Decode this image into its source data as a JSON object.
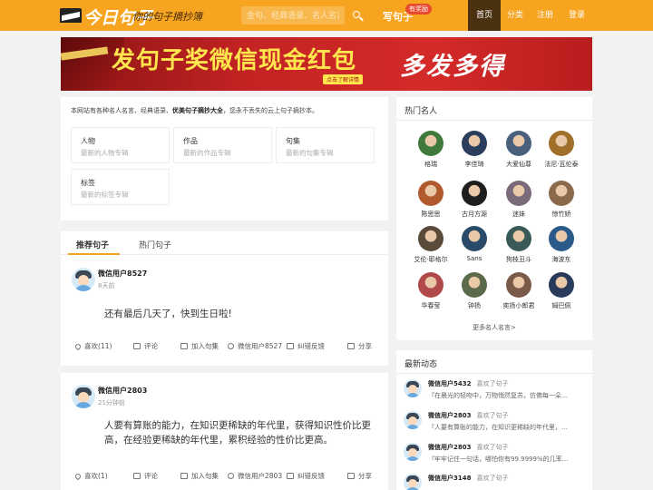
{
  "header": {
    "logo_text": "今日句子",
    "logo_sub": "你的句子摘抄簿",
    "search_placeholder": "金句、经典语录、名人名言",
    "write_label": "写句子",
    "reward_badge": "有奖励",
    "nav": [
      "首页",
      "分类",
      "注册",
      "登录"
    ],
    "accent": "#f7a421",
    "active_bg": "#4a3210"
  },
  "banner": {
    "title_left": "发句子奖微信现金红包",
    "title_right": "多发多得",
    "button": "点击了解详情"
  },
  "intro": {
    "text_pre": "本网站有各种名人名言、经典语录、",
    "text_bold": "优美句子摘抄大全",
    "text_post": "，您永不丢失的云上句子摘抄本。",
    "cards": [
      {
        "title": "人物",
        "sub": "最新的人物专辑"
      },
      {
        "title": "作品",
        "sub": "最新的作品专辑"
      },
      {
        "title": "句集",
        "sub": "最新的句集专辑"
      },
      {
        "title": "标签",
        "sub": "最新的标签专辑"
      }
    ]
  },
  "feed": {
    "tabs": [
      "推荐句子",
      "热门句子"
    ],
    "posts": [
      {
        "user": "微信用户8527",
        "time": "8天前",
        "body": "还有最后几天了，快到生日啦!",
        "actions": {
          "like": "喜欢(11)",
          "comment": "评论",
          "add": "加入句集",
          "author": "微信用户8527",
          "report": "纠错反馈",
          "share": "分享"
        }
      },
      {
        "user": "微信用户2803",
        "time": "21分钟前",
        "body": "人要有算账的能力，在知识更稀缺的年代里，获得知识性价比更高，在经验更稀缺的年代里，累积经验的性价比更高。",
        "actions": {
          "like": "喜欢(1)",
          "comment": "评论",
          "add": "加入句集",
          "author": "微信用户2803",
          "report": "纠错反馈",
          "share": "分享"
        }
      }
    ]
  },
  "hot": {
    "title": "热门名人",
    "people": [
      "格瑞",
      "李佳琦",
      "大爱仙尊",
      "法尼·瓦伦泰",
      "陈思思",
      "古月方源",
      "迷妹",
      "惊竹娇",
      "艾伦·耶格尔",
      "Sans",
      "狗枝丑斗",
      "海波东",
      "华春莹",
      "钟扬",
      "奕扬小郎君",
      "姆巴佩"
    ],
    "colors": [
      "#3f7a3a",
      "#2c3e5e",
      "#4a5f7a",
      "#a0702b",
      "#b05a2e",
      "#1e1e1e",
      "#7a6a7a",
      "#8a6a4a",
      "#5a4a3a",
      "#2a4a6a",
      "#3a5a5a",
      "#2a5a8a",
      "#b04a4a",
      "#5a6a4a",
      "#7a5a4a",
      "#2a3a5a"
    ],
    "more": "更多名人名言>"
  },
  "dynamics": {
    "title": "最新动态",
    "items": [
      {
        "user": "微信用户5432",
        "action": "喜欢了句子",
        "text": "『在晨光的轻吻中，万物悄然复苏，仿佛每一朵…"
      },
      {
        "user": "微信用户2803",
        "action": "喜欢了句子",
        "text": "『人要有算账的能力，在知识更稀缺的年代里，…"
      },
      {
        "user": "微信用户2803",
        "action": "喜欢了句子",
        "text": "『牢牢记住一句话，哪怕你有99.9999%的几率成…"
      },
      {
        "user": "微信用户3148",
        "action": "喜欢了句子",
        "text": ""
      }
    ]
  }
}
